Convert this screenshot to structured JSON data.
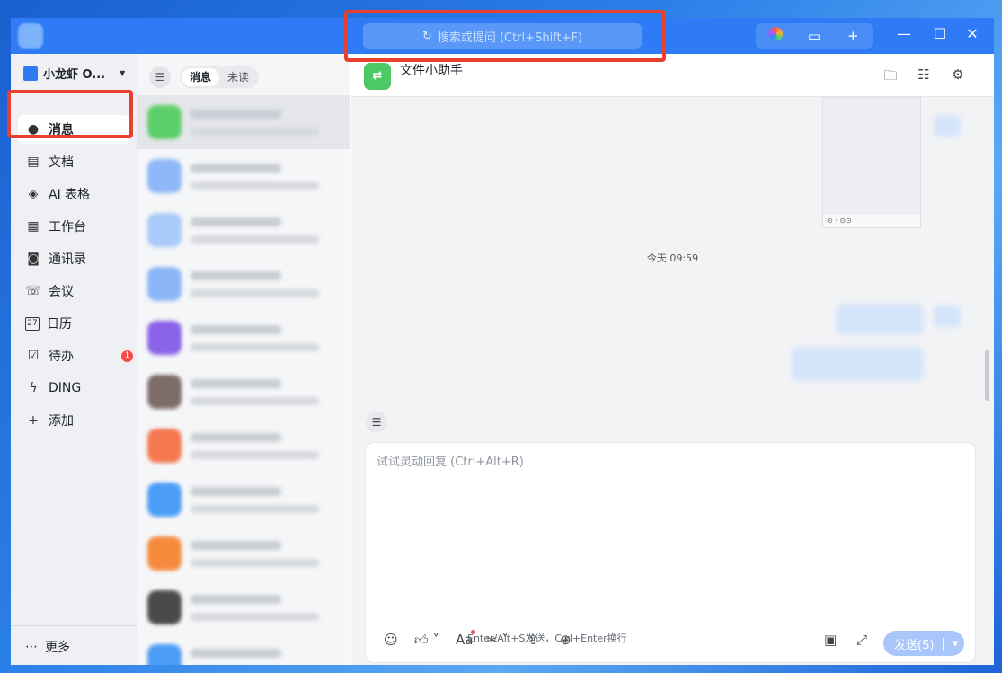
{
  "search": {
    "placeholder": "搜索或提问 (Ctrl+Shift+F)"
  },
  "sidebar": {
    "org_name": "小龙虾 O...",
    "items": [
      {
        "label": "消息",
        "icon": "chat-bubble-icon"
      },
      {
        "label": "文档",
        "icon": "document-icon"
      },
      {
        "label": "AI 表格",
        "icon": "cube-icon"
      },
      {
        "label": "工作台",
        "icon": "grid-icon"
      },
      {
        "label": "通讯录",
        "icon": "contacts-icon"
      },
      {
        "label": "会议",
        "icon": "phone-icon"
      },
      {
        "label": "日历",
        "icon": "calendar-icon",
        "calendar_day": "27"
      },
      {
        "label": "待办",
        "icon": "checkbox-icon",
        "badge": "1"
      },
      {
        "label": "DING",
        "icon": "lightning-icon"
      },
      {
        "label": "添加",
        "icon": "plus-icon"
      }
    ],
    "more_label": "更多"
  },
  "list": {
    "tabs": [
      "消息",
      "未读"
    ]
  },
  "chat": {
    "title": "文件小助手",
    "time_separator": "今天 09:59",
    "composer_placeholder": "试试灵动回复 (Ctrl+Alt+R)",
    "send_label": "发送(S)",
    "send_hint": "Enter/Alt+S发送，Ctrl+Enter换行"
  },
  "colors": {
    "accent": "#2f7bf5",
    "highlight": "#e8402c",
    "badge": "#f54a45"
  }
}
